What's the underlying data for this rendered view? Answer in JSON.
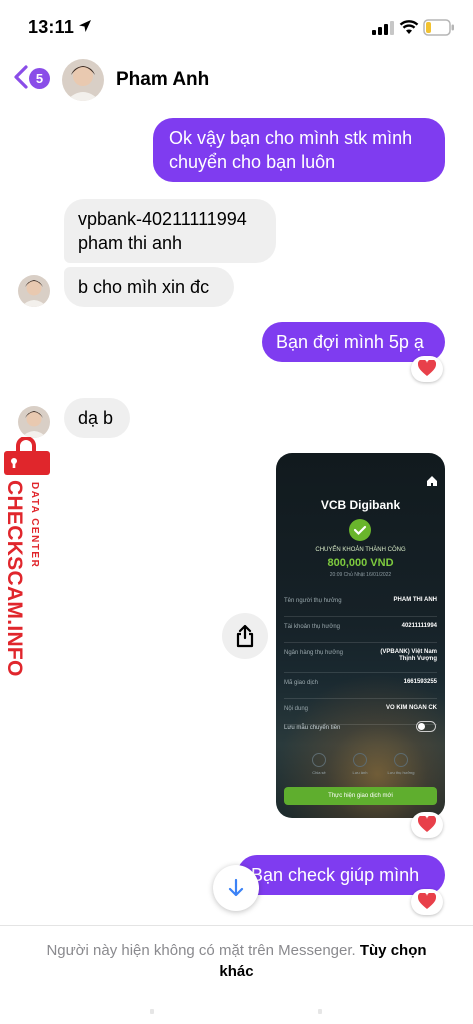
{
  "status": {
    "time": "13:11"
  },
  "header": {
    "back_badge": "5",
    "contact_name": "Pham Anh"
  },
  "messages": [
    {
      "dir": "out",
      "text": "Ok vậy bạn cho mình stk mình chuyển cho bạn luôn"
    },
    {
      "dir": "in",
      "text": "vpbank-40211111994 pham thi anh"
    },
    {
      "dir": "in",
      "text": "b cho mìh xin đc"
    },
    {
      "dir": "out",
      "text": "Bạn đợi mình 5p ạ",
      "reaction": "heart"
    },
    {
      "dir": "in",
      "text": "dạ b"
    },
    {
      "dir": "out",
      "type": "image",
      "reaction": "heart"
    },
    {
      "dir": "out",
      "text": "Bạn check giúp mình",
      "reaction": "heart"
    }
  ],
  "receipt": {
    "brand": "VCB Digibank",
    "status": "CHUYỂN KHOẢN THÀNH CÔNG",
    "amount": "800,000 VND",
    "date": "20:09 Chủ Nhật 16/01/2022",
    "rows": [
      {
        "label": "Tên người thụ hưởng",
        "value": "PHAM THI ANH"
      },
      {
        "label": "Tài khoản thụ hưởng",
        "value": "40211111994"
      },
      {
        "label": "Ngân hàng thụ hưởng",
        "value": "(VPBANK) Việt Nam Thịnh Vượng"
      },
      {
        "label": "Mã giao dịch",
        "value": "1661593255"
      },
      {
        "label": "Nội dung",
        "value": "VO KIM NGAN CK"
      }
    ],
    "save_template": "Lưu mẫu chuyển tiền",
    "actions": [
      "Chia sẻ",
      "Lưu ảnh",
      "Lưu thụ hưởng"
    ],
    "cta": "Thực hiện giao dịch mới"
  },
  "watermark": {
    "site": "CHECKSCAM.INFO",
    "tag": "DATA CENTER"
  },
  "footer": {
    "notice": "Người này hiện không có mặt trên Messenger.",
    "options": "Tùy chọn khác"
  },
  "colors": {
    "accent": "#7f3cf0",
    "incoming": "#efefef",
    "watermark": "#e0262c"
  }
}
